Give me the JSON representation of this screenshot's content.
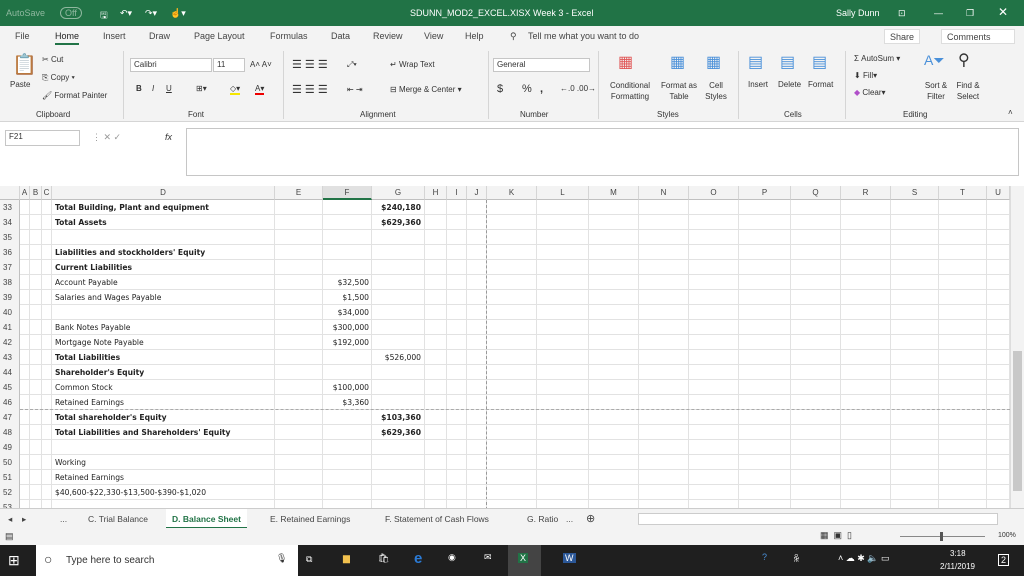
{
  "titlebar": {
    "autosave": "AutoSave",
    "autosave_state": "Off",
    "filename": "SDUNN_MOD2_EXCEL.XISX Week 3  -  Excel",
    "user": "Sally Dunn"
  },
  "tabs": [
    "File",
    "Home",
    "Insert",
    "Draw",
    "Page Layout",
    "Formulas",
    "Data",
    "Review",
    "View",
    "Help"
  ],
  "tell_me": "Tell me what you want to do",
  "share": "Share",
  "comments": "Comments",
  "ribbon": {
    "clipboard": {
      "paste": "Paste",
      "cut": "Cut",
      "copy": "Copy",
      "format_painter": "Format Painter",
      "label": "Clipboard"
    },
    "font": {
      "name": "Calibri",
      "size": "11",
      "label": "Font",
      "bold": "B",
      "italic": "I",
      "underline": "U"
    },
    "alignment": {
      "wrap": "Wrap Text",
      "merge": "Merge & Center",
      "label": "Alignment"
    },
    "number": {
      "format": "General",
      "label": "Number",
      "currency": "$",
      "percent": "%",
      "comma": ","
    },
    "styles": {
      "conditional": "Conditional Formatting",
      "format_table": "Format as Table",
      "cell_styles": "Cell Styles",
      "label": "Styles"
    },
    "cells": {
      "insert": "Insert",
      "delete": "Delete",
      "format": "Format",
      "label": "Cells"
    },
    "editing": {
      "autosum": "AutoSum",
      "fill": "Fill",
      "clear": "Clear",
      "sort": "Sort & Filter",
      "find": "Find & Select",
      "label": "Editing"
    }
  },
  "formula_bar": {
    "name_box": "F21",
    "fx": "fx",
    "value": ""
  },
  "columns": [
    "A",
    "B",
    "C",
    "D",
    "E",
    "F",
    "G",
    "H",
    "I",
    "J",
    "K",
    "L",
    "M",
    "N",
    "O",
    "P",
    "Q",
    "R",
    "S",
    "T",
    "U"
  ],
  "rows": [
    {
      "n": "33",
      "d": "Total Building, Plant and equipment",
      "db": true,
      "f": "",
      "g": "$240,180",
      "gb": true
    },
    {
      "n": "34",
      "d": "Total Assets",
      "db": true,
      "f": "",
      "g": "$629,360",
      "gb": true
    },
    {
      "n": "35",
      "d": "",
      "f": "",
      "g": ""
    },
    {
      "n": "36",
      "d": "Liabilities and stockholders' Equity",
      "db": true,
      "f": "",
      "g": ""
    },
    {
      "n": "37",
      "d": "Current Liabilities",
      "db": true,
      "f": "",
      "g": ""
    },
    {
      "n": "38",
      "d": "Account Payable",
      "f": "$32,500",
      "g": ""
    },
    {
      "n": "39",
      "d": "Salaries and Wages Payable",
      "f": "$1,500",
      "g": ""
    },
    {
      "n": "40",
      "d": "",
      "f": "$34,000",
      "g": ""
    },
    {
      "n": "41",
      "d": "Bank Notes Payable",
      "f": "$300,000",
      "g": ""
    },
    {
      "n": "42",
      "d": "Mortgage Note Payable",
      "f": "$192,000",
      "g": ""
    },
    {
      "n": "43",
      "d": "Total Liabilities",
      "db": true,
      "f": "",
      "g": "$526,000"
    },
    {
      "n": "44",
      "d": "Shareholder's Equity",
      "db": true,
      "f": "",
      "g": ""
    },
    {
      "n": "45",
      "d": "Common Stock",
      "f": "$100,000",
      "g": ""
    },
    {
      "n": "46",
      "d": "Retained Earnings",
      "f": "$3,360",
      "g": ""
    },
    {
      "n": "47",
      "d": "Total shareholder's Equity",
      "db": true,
      "f": "",
      "g": "$103,360",
      "gb": true
    },
    {
      "n": "48",
      "d": "Total Liabilities and Shareholders' Equity",
      "db": true,
      "f": "",
      "g": "$629,360",
      "gb": true
    },
    {
      "n": "49",
      "d": "",
      "f": "",
      "g": ""
    },
    {
      "n": "50",
      "d": "Working",
      "f": "",
      "g": ""
    },
    {
      "n": "51",
      "d": "Retained Earnings",
      "f": "",
      "g": ""
    },
    {
      "n": "52",
      "d": "$40,600-$22,330-$13,500-$390-$1,020",
      "f": "",
      "g": ""
    },
    {
      "n": "53",
      "d": "",
      "f": "",
      "g": ""
    }
  ],
  "sheet_tabs": [
    "...",
    "C. Trial Balance",
    "D. Balance Sheet",
    "E. Retained Earnings",
    "F. Statement of Cash Flows",
    "G. Ratio",
    "..."
  ],
  "active_sheet": "D. Balance Sheet",
  "status": {
    "zoom": "100%"
  },
  "taskbar": {
    "search": "Type here to search",
    "time": "3:18",
    "date": "2/11/2019",
    "notifications": "2"
  },
  "colors": {
    "excel_green": "#217346"
  }
}
